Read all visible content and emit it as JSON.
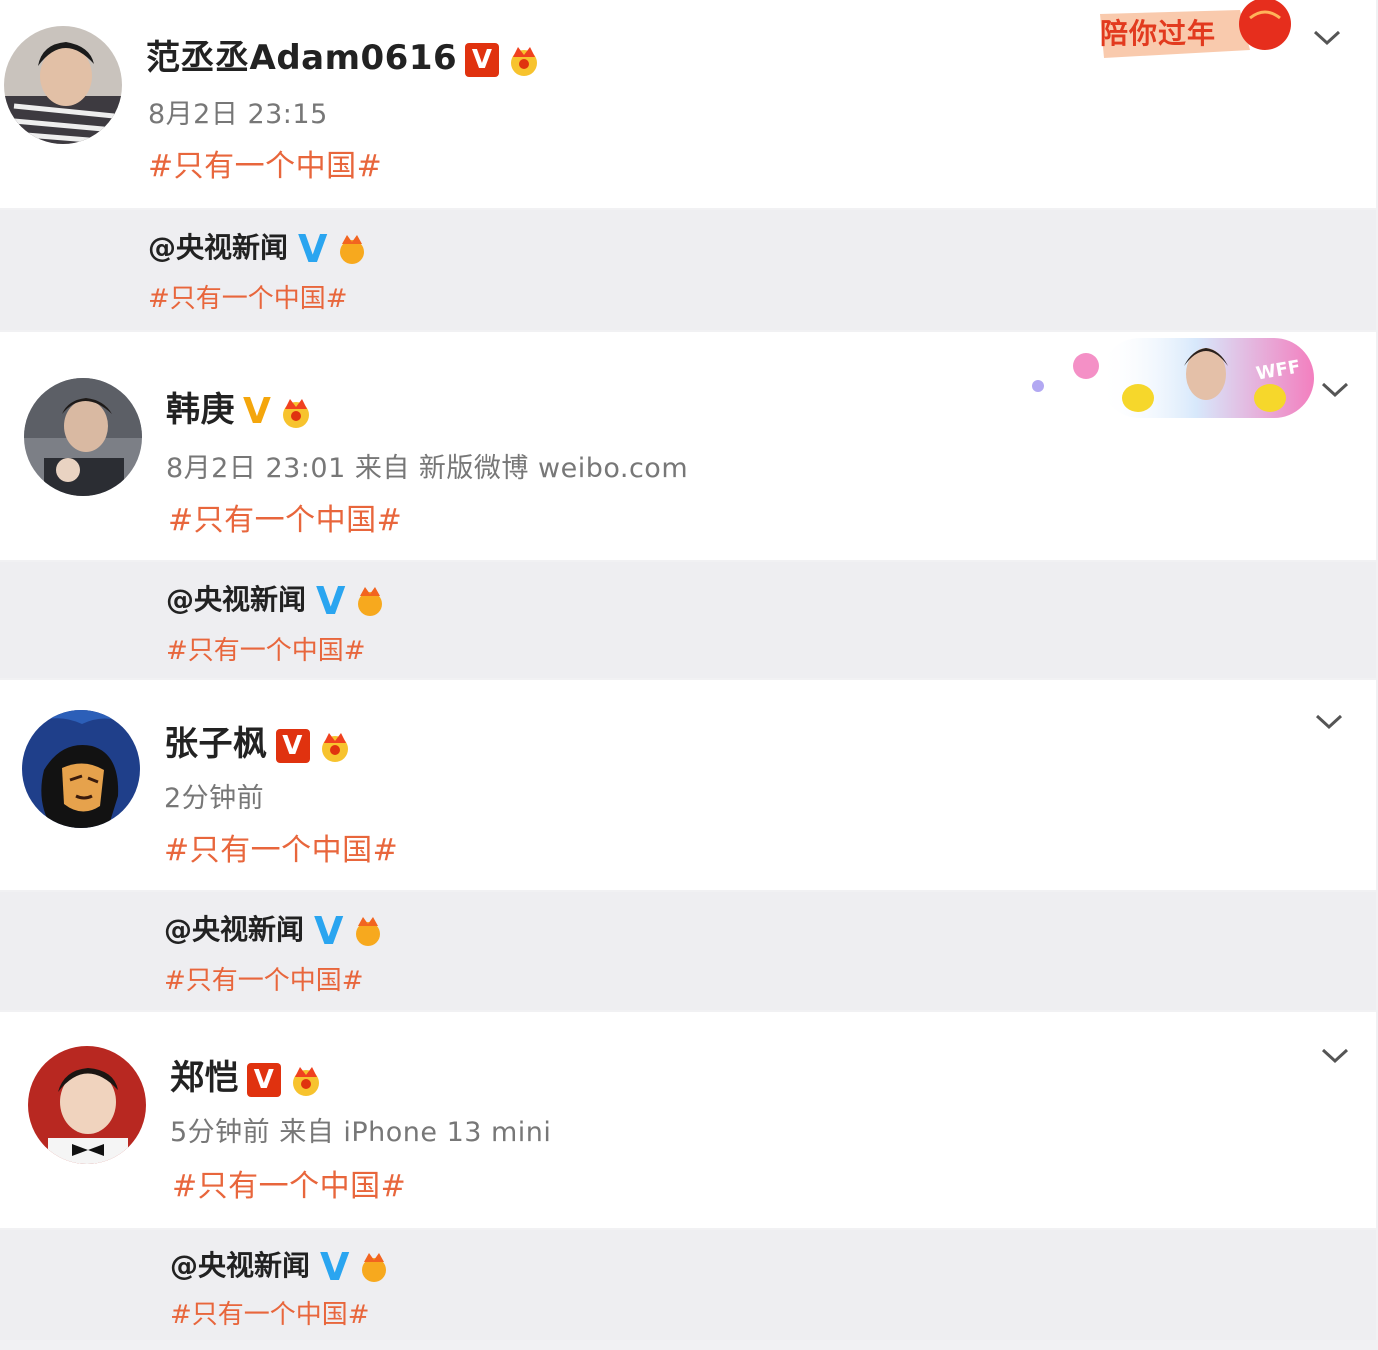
{
  "posts": [
    {
      "name": "范丞丞Adam0616",
      "badge": "V",
      "time": "8月2日 23:15",
      "topic": "#只有一个中国#",
      "repost": {
        "name": "@央视新闻",
        "badge": "V",
        "topic": "#只有一个中国#"
      },
      "banner_text": "陪你过年"
    },
    {
      "name": "韩庚",
      "badge": "V",
      "time": "8月2日 23:01 来自 新版微博 weibo.com",
      "topic": "#只有一个中国#",
      "repost": {
        "name": "@央视新闻",
        "badge": "V",
        "topic": "#只有一个中国#"
      },
      "banner_text": "WFF"
    },
    {
      "name": "张子枫",
      "badge": "V",
      "time": "2分钟前",
      "topic": "#只有一个中国#",
      "repost": {
        "name": "@央视新闻",
        "badge": "V",
        "topic": "#只有一个中国#"
      }
    },
    {
      "name": "郑恺",
      "badge": "V",
      "time": "5分钟前 来自 iPhone 13 mini",
      "topic": "#只有一个中国#",
      "repost": {
        "name": "@央视新闻",
        "badge": "V",
        "topic": "#只有一个中国#"
      }
    }
  ],
  "colors": {
    "topic": "#e8663c",
    "verified_red": "#e0320f",
    "verified_gold": "#f4a60c",
    "verified_blue": "#2aa5f0",
    "repost_bg": "#eeeef1"
  },
  "icons": [
    "chevron-down-icon",
    "crown-icon",
    "verified-badge-icon",
    "lantern-icon",
    "avatar"
  ]
}
